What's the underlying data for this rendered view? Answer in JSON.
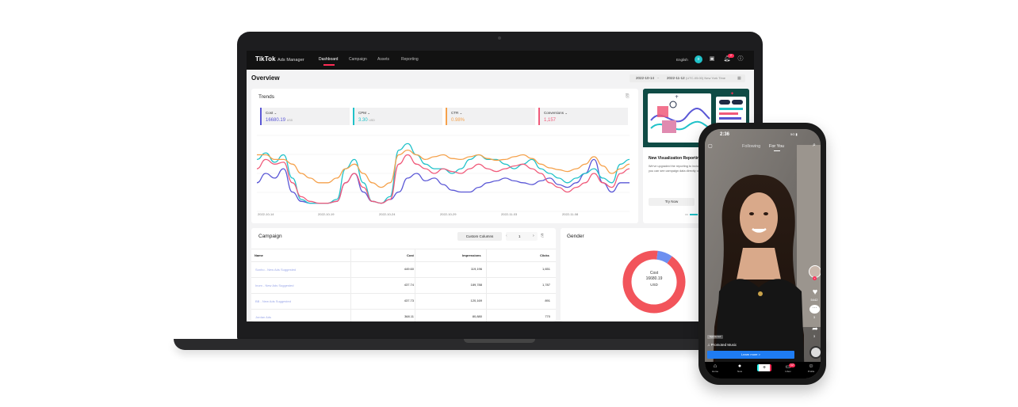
{
  "nav": {
    "logo": "TikTok",
    "logo_sub": "Ads Manager",
    "tabs": [
      "Dashboard",
      "Campaign",
      "Assets",
      "Reporting"
    ],
    "language": "English",
    "avatar": "o",
    "notif_count": "2"
  },
  "overview": {
    "title": "Overview",
    "date_start": "2022-10-14",
    "date_end": "2022-11-12",
    "timezone": "(UTC-05:00) New York Time"
  },
  "trends": {
    "title": "Trends",
    "metrics": [
      {
        "label": "Cost",
        "value": "16680.19",
        "unit": "USD",
        "color": "#5a57d6"
      },
      {
        "label": "CPM",
        "value": "3.30",
        "unit": "USD",
        "color": "#20c2c9"
      },
      {
        "label": "CTR",
        "value": "0.98%",
        "unit": "",
        "color": "#f5a14b"
      },
      {
        "label": "Conversions",
        "value": "1,157",
        "unit": "",
        "color": "#f05a7a"
      }
    ]
  },
  "chart_data": {
    "type": "line",
    "x_tick_labels": [
      "2022-10-14",
      "2022-10-19",
      "2022-10-24",
      "2022-10-29",
      "2022-11-03",
      "2022-11-08"
    ],
    "series": [
      {
        "name": "Cost",
        "color": "#5a57d6",
        "values": [
          30,
          40,
          35,
          45,
          20,
          10,
          8,
          8,
          8,
          10,
          30,
          40,
          20,
          10,
          8,
          12,
          20,
          35,
          40,
          32,
          35,
          28,
          22,
          20,
          20,
          25,
          30,
          32,
          35,
          32,
          30,
          28,
          32,
          35,
          28,
          25,
          30,
          40,
          55,
          30,
          20,
          30,
          30
        ]
      },
      {
        "name": "CPM",
        "color": "#20c2c9",
        "values": [
          55,
          62,
          52,
          60,
          35,
          12,
          8,
          8,
          8,
          12,
          45,
          55,
          30,
          10,
          8,
          15,
          65,
          72,
          60,
          50,
          45,
          45,
          40,
          45,
          55,
          60,
          55,
          55,
          50,
          45,
          50,
          55,
          45,
          40,
          35,
          30,
          35,
          40,
          45,
          35,
          30,
          50,
          55
        ]
      },
      {
        "name": "CTR",
        "color": "#f5a14b",
        "values": [
          60,
          60,
          55,
          55,
          50,
          40,
          35,
          30,
          30,
          35,
          45,
          50,
          40,
          30,
          25,
          30,
          60,
          65,
          60,
          55,
          58,
          60,
          56,
          55,
          58,
          60,
          56,
          54,
          55,
          58,
          60,
          56,
          50,
          46,
          44,
          42,
          45,
          50,
          58,
          48,
          40,
          45,
          50
        ]
      },
      {
        "name": "Conversions",
        "color": "#f05a7a",
        "values": [
          45,
          55,
          50,
          52,
          30,
          15,
          10,
          8,
          8,
          10,
          30,
          40,
          25,
          10,
          8,
          12,
          50,
          60,
          50,
          45,
          40,
          45,
          42,
          40,
          45,
          50,
          45,
          42,
          45,
          48,
          50,
          45,
          40,
          30,
          25,
          20,
          25,
          30,
          40,
          30,
          25,
          40,
          45
        ]
      }
    ],
    "ylim": [
      0,
      80
    ],
    "grid": true
  },
  "promo": {
    "title": "New Visualization Reporting",
    "desc": "We've upgraded the reporting to include a pivot table and trend line so you can see campaign data directly on the page.",
    "button": "Try Now"
  },
  "campaign": {
    "title": "Campaign",
    "custom_columns": "Custom Columns",
    "page": "1",
    "columns": [
      "Name",
      "Cost",
      "Impressions",
      "Clicks"
    ],
    "rows": [
      {
        "name": "Sonho - New Ads Suggested",
        "cost": "449.60",
        "impressions": "119,196",
        "clicks": "1,651"
      },
      {
        "name": "Inom - New Ads Suggested",
        "cost": "437.74",
        "impressions": "189,788",
        "clicks": "1,787"
      },
      {
        "name": "BB - New Ads Suggested",
        "cost": "437.73",
        "impressions": "120,169",
        "clicks": "891"
      },
      {
        "name": "Jordan Ads",
        "cost": "368.11",
        "impressions": "80,880",
        "clicks": "770"
      }
    ]
  },
  "gender": {
    "title": "Gender",
    "center_label": "Cost",
    "center_value": "16680.19",
    "center_unit": "USD",
    "segments": [
      {
        "share": 0.92,
        "color": "#f2545b"
      },
      {
        "share": 0.08,
        "color": "#6d8ff0"
      }
    ]
  },
  "phone": {
    "time": "2:36",
    "status": "5G",
    "tabs": [
      "Following",
      "For You"
    ],
    "likes": "5442",
    "comments": "3",
    "shares": "3",
    "sponsored": "Sponsored",
    "music": "♫ Promoted Music",
    "cta": "Learn more >",
    "nav": [
      "Home",
      "Now",
      "",
      "Inbox",
      "Profile"
    ],
    "inbox_badge": "12"
  }
}
